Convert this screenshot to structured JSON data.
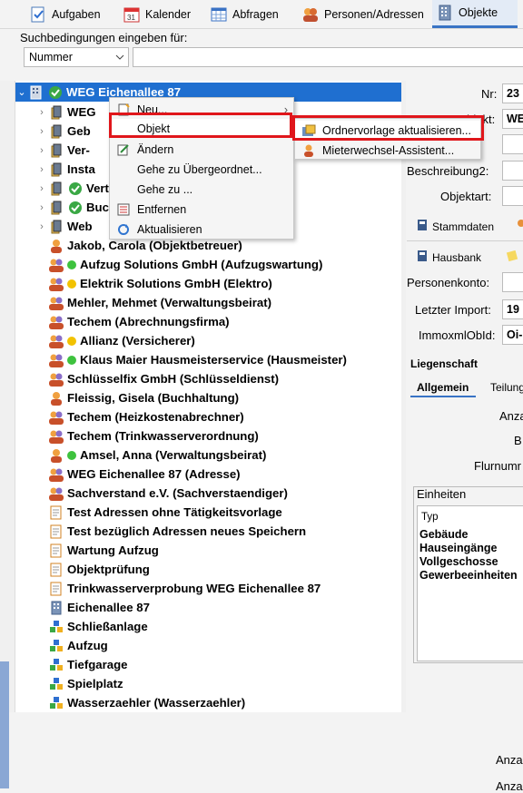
{
  "toolbar": {
    "tabs": [
      {
        "label": "Aufgaben",
        "icon": "tasks-icon"
      },
      {
        "label": "Kalender",
        "icon": "calendar-icon"
      },
      {
        "label": "Abfragen",
        "icon": "query-icon"
      },
      {
        "label": "Personen/Adressen",
        "icon": "persons-icon"
      },
      {
        "label": "Objekte",
        "icon": "objects-icon"
      }
    ]
  },
  "search": {
    "label": "Suchbedingungen eingeben für:",
    "field": "Nummer",
    "value": ""
  },
  "tree": {
    "root": "WEG Eichenallee 87",
    "items": [
      "WEG",
      "Geb",
      "Ver-",
      "Insta",
      "Vert",
      "Buch",
      "Web",
      "Jakob, Carola (Objektbetreuer)",
      "Aufzug Solutions GmbH (Aufzugswartung)",
      "Elektrik Solutions GmbH (Elektro)",
      "Mehler, Mehmet (Verwaltungsbeirat)",
      "Techem (Abrechnungsfirma)",
      "Allianz (Versicherer)",
      "Klaus Maier Hausmeisterservice (Hausmeister)",
      "Schlüsselfix GmbH (Schlüsseldienst)",
      "Fleissig, Gisela (Buchhaltung)",
      "Techem (Heizkostenabrechner)",
      "Techem (Trinkwasserverordnung)",
      "Amsel, Anna (Verwaltungsbeirat)",
      "WEG Eichenallee 87  (Adresse)",
      "Sachverstand e.V. (Sachverstaendiger)",
      "Test Adressen ohne Tätigkeitsvorlage",
      "Test bezüglich Adressen neues Speichern",
      "Wartung Aufzug",
      "Objektprüfung",
      "Trinkwasserverprobung WEG Eichenallee 87",
      "Eichenallee 87",
      "Schließanlage",
      "Aufzug",
      "Tiefgarage",
      "Spielplatz",
      "Wasserzaehler (Wasserzaehler)"
    ]
  },
  "menu": {
    "items": [
      "Neu...",
      "Objekt",
      "Ändern",
      "Gehe zu Übergeordnet...",
      "Gehe zu ...",
      "Entfernen",
      "Aktualisieren"
    ]
  },
  "submenu": {
    "items": [
      "Ordnervorlage aktualisieren...",
      "Mieterwechsel-Assistent..."
    ]
  },
  "detail": {
    "nr_label": "Nr:",
    "nr_value": "23",
    "objekt_label": "Objekt:",
    "objekt_value": "WE",
    "beschreibung2_label": "Beschreibung2:",
    "objektart_label": "Objektart:",
    "tab_stammdaten": "Stammdaten",
    "tab_hausbank": "Hausbank",
    "personenkonto_label": "Personenkonto:",
    "letzter_import_label": "Letzter Import:",
    "letzter_import_value": "19",
    "immoxml_label": "ImmoxmlObId:",
    "immoxml_value": "Oi-",
    "liegenschaft": "Liegenschaft",
    "tab_allgemein": "Allgemein",
    "tab_teilung": "Teilung",
    "anz_label": "Anza",
    "b_label": "B",
    "flurnum_label": "Flurnumr",
    "einheiten_title": "Einheiten",
    "einheiten_header": "Typ",
    "einheiten_rows": [
      "Gebäude",
      "Hauseingänge",
      "Vollgeschosse",
      "Gewerbeeinheiten"
    ],
    "anzah_label1": "Anzah",
    "anzah_label2": "Anzah"
  }
}
